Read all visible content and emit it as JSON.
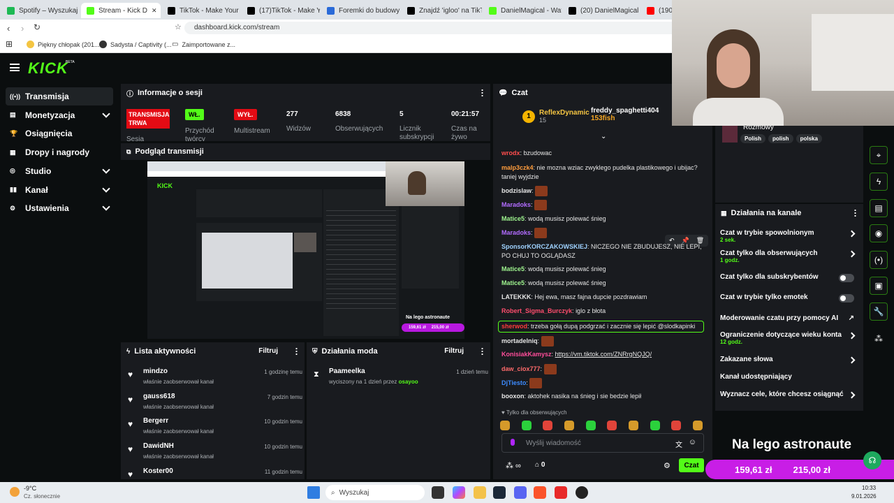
{
  "browser": {
    "tabs": [
      {
        "title": "Spotify – Wyszukaj",
        "color": "#1db954"
      },
      {
        "title": "Stream - Kick D",
        "color": "#53fc18",
        "active": true
      },
      {
        "title": "TikTok - Make Your Da",
        "color": "#000000"
      },
      {
        "title": "(17)TikTok - Make You",
        "color": "#000000"
      },
      {
        "title": "Foremki do budowy ig",
        "color": "#2a6ad8"
      },
      {
        "title": "Znajdź 'igloo' na TikTo",
        "color": "#000000"
      },
      {
        "title": "DanielMagical - Watch",
        "color": "#53fc18"
      },
      {
        "title": "(20) DanielMagical (@",
        "color": "#000000"
      },
      {
        "title": "(190) Y",
        "color": "#ff0000"
      }
    ],
    "url": "dashboard.kick.com/stream",
    "bookmarks": [
      "Piękny chłopak (201...",
      "Sadysta / Captivity (...",
      "Zaimportowane z..."
    ]
  },
  "app": {
    "logo": "KICK",
    "logo_beta": "BETA",
    "accent": "#53fc18"
  },
  "sidebar": {
    "items": [
      {
        "label": "Transmisja",
        "icon": "broadcast-icon",
        "active": true,
        "chevron": false
      },
      {
        "label": "Monetyzacja",
        "icon": "money-icon",
        "chevron": true
      },
      {
        "label": "Osiągnięcia",
        "icon": "trophy-icon",
        "chevron": false
      },
      {
        "label": "Dropy i nagrody",
        "icon": "gift-icon",
        "chevron": false
      },
      {
        "label": "Studio",
        "icon": "studio-icon",
        "chevron": true
      },
      {
        "label": "Kanał",
        "icon": "channel-icon",
        "chevron": true
      },
      {
        "label": "Ustawienia",
        "icon": "gear-icon",
        "chevron": true
      }
    ]
  },
  "session": {
    "title": "Informacje o sesji",
    "status_badge": "TRANSMISJA TRWA",
    "status_label": "Sesja",
    "creator_badge": "WŁ.",
    "creator_label": "Przychód twórcy",
    "multistream_badge": "WYŁ.",
    "multistream_label": "Multistream",
    "viewers": "277",
    "viewers_label": "Widzów",
    "followers": "6838",
    "followers_label": "Obserwujących",
    "subs": "5",
    "subs_label": "Licznik subskrypcji",
    "time": "00:21:57",
    "time_label": "Czas na żywo"
  },
  "preview": {
    "title": "Podgląd transmisji",
    "overlay_text": "Na lego astronaute",
    "amount_1": "159,61 zł",
    "amount_2": "215,00 zł"
  },
  "activity": {
    "title": "Lista aktywności",
    "filter": "Filtruj",
    "items": [
      {
        "name": "mindzo",
        "sub": "właśnie zaobserwował kanał",
        "time": "1 godzinę temu"
      },
      {
        "name": "gauss618",
        "sub": "właśnie zaobserwował kanał",
        "time": "7 godzin temu"
      },
      {
        "name": "Bergerr",
        "sub": "właśnie zaobserwował kanał",
        "time": "10 godzin temu"
      },
      {
        "name": "DawidNH",
        "sub": "właśnie zaobserwował kanał",
        "time": "10 godzin temu"
      },
      {
        "name": "Koster00",
        "sub": "",
        "time": "11 godzin temu"
      }
    ]
  },
  "mod_actions": {
    "title": "Działania moda",
    "filter": "Filtruj",
    "items": [
      {
        "name": "Paameelka",
        "sub_prefix": "wyciszony na 1 dzień przez",
        "by": "osayoo",
        "time": "1 dzień temu"
      }
    ]
  },
  "chat": {
    "title": "Czat",
    "gifter_1": {
      "name": "ReflexDynamic",
      "count": "15",
      "rank": "1"
    },
    "gifter_2": {
      "name": "freddy_spaghetti404",
      "count": "153fish"
    },
    "messages": [
      {
        "user": "wrodx",
        "color": "#ff4d4d",
        "text": "bzudowac"
      },
      {
        "user": "malp3czk4",
        "color": "#ff9d3d",
        "text": "nie mozna wziac zwyklego pudelka plastikowego i ubijac? taniej wyjdzie"
      },
      {
        "user": "bodzislaw",
        "color": "#e6e6e6",
        "text": "",
        "emote": true
      },
      {
        "user": "Maradoks",
        "color": "#b26cff",
        "text": "",
        "emote": true
      },
      {
        "user": "Matice5",
        "color": "#9ff58f",
        "text": "wodą musisz polewać śnieg"
      },
      {
        "user": "Maradoks",
        "color": "#b26cff",
        "text": "",
        "emote": true
      },
      {
        "user": "SponsorKORCZAKOWSKIEJ",
        "color": "#9fd2ff",
        "text": "NICZEGO NIE ZBUDUJESZ, NIE LEPI, PO CHUJ TO OGLĄDASZ"
      },
      {
        "user": "Matice5",
        "color": "#9ff58f",
        "text": "wodą musisz polewać śnieg"
      },
      {
        "user": "Matice5",
        "color": "#9ff58f",
        "text": "wodą musisz polewać śnieg"
      },
      {
        "user": "LATEKKK",
        "color": "#e6e6e6",
        "text": "Hej ewa, masz fajna dupcie pozdrawiam"
      },
      {
        "user": "Robert_Sigma_Burczyk",
        "color": "#ff4d6d",
        "text": "iglo z błota"
      },
      {
        "user": "sherwod",
        "color": "#ff3b3b",
        "text": "trzeba gołą dupą podgrzać i zacznie się lepić @slodkapinki",
        "highlight": true
      },
      {
        "user": "mortadelniq",
        "color": "#e6e6e6",
        "text": "",
        "emote": true
      },
      {
        "user": "KonisiakKamysz",
        "color": "#ff4d9a",
        "text": "https://vm.tiktok.com/ZNRrgNQJQ/",
        "link": true
      },
      {
        "user": "daw_ciox777",
        "color": "#ff6b6b",
        "text": "",
        "emote": true
      },
      {
        "user": "DjTiesto",
        "color": "#3d8bff",
        "text": "",
        "emote": true
      },
      {
        "user": "booxon",
        "color": "#e6e6e6",
        "text": "aktohek nasika na śnieg i sie bedzie lepił"
      }
    ],
    "followers_only": "Tylko dla obserwujących",
    "input_placeholder": "Wyślij wiadomość",
    "send_label": "Czat",
    "points": "0"
  },
  "channel": {
    "category": "Rozmowy",
    "tags": [
      "Polish",
      "polish",
      "polska"
    ],
    "actions_title": "Działania na kanale",
    "actions": [
      {
        "label": "Czat w trybie spowolnionym",
        "sub": "2 sek.",
        "type": "arrow"
      },
      {
        "label": "Czat tylko dla obserwujących",
        "sub": "1 godz.",
        "type": "arrow"
      },
      {
        "label": "Czat tylko dla subskrybentów",
        "sub": "",
        "type": "toggle"
      },
      {
        "label": "Czat w trybie tylko emotek",
        "sub": "",
        "type": "toggle"
      },
      {
        "label": "Moderowanie czatu przy pomocy AI",
        "sub": "",
        "type": "external"
      },
      {
        "label": "Ograniczenie dotyczące wieku konta",
        "sub": "12 godz.",
        "type": "arrow"
      },
      {
        "label": "Zakazane słowa",
        "sub": "",
        "type": "arrow"
      },
      {
        "label": "Kanał udostępniający",
        "sub": "",
        "type": "none"
      },
      {
        "label": "Wyznacz cele, które chcesz osiągnąć",
        "sub": "",
        "type": "arrow"
      }
    ]
  },
  "overlay": {
    "title": "Na lego astronaute",
    "amount_1": "159,61 zł",
    "amount_2": "215,00 zł"
  },
  "taskbar": {
    "weather_temp": "-9°C",
    "weather_desc": "Cz. słonecznie",
    "search": "Wyszukaj",
    "time": "10:33",
    "date": "9.01.2026"
  }
}
